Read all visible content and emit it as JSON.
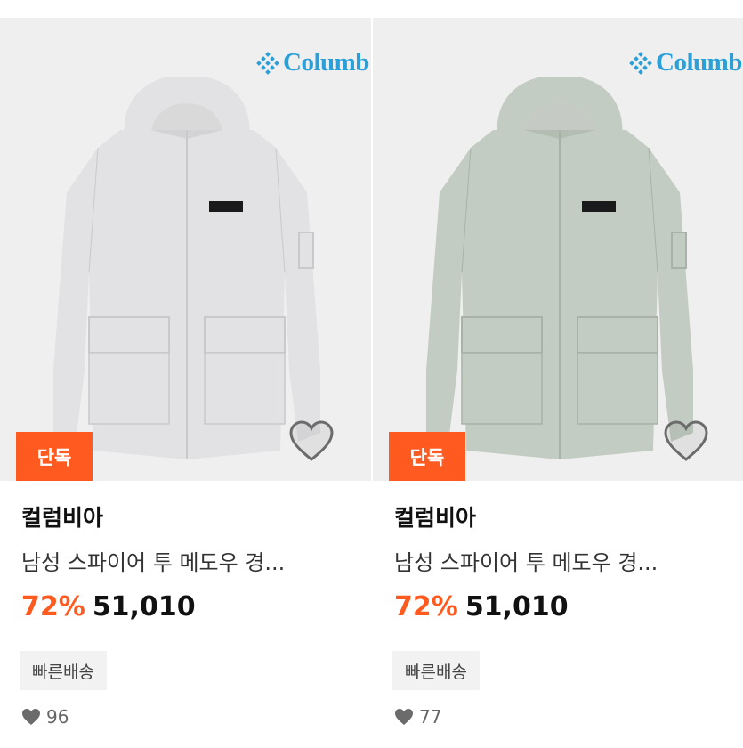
{
  "products": [
    {
      "brand": "컬럼비아",
      "name": "남성 스파이어 투 메도우 경...",
      "discount": "72%",
      "price": "51,010",
      "badge": "단독",
      "tag": "빠른배송",
      "likes": "96",
      "logo_text": "Columb",
      "jacket_color": "#e2e2e4",
      "jacket_shadow": "#c9c9cc"
    },
    {
      "brand": "컬럼비아",
      "name": "남성 스파이어 투 메도우 경...",
      "discount": "72%",
      "price": "51,010",
      "badge": "단독",
      "tag": "빠른배송",
      "likes": "77",
      "logo_text": "Columb",
      "jacket_color": "#c3ccc2",
      "jacket_shadow": "#a8b2a7"
    }
  ],
  "colors": {
    "accent": "#ff5a1f",
    "logo": "#2a9fd8",
    "thumb_bg": "#efefef",
    "tag_bg": "#f2f2f2"
  },
  "icons": {
    "wishlist": "heart-outline-icon",
    "likes": "heart-filled-icon",
    "logo": "columbia-diamond-logo"
  }
}
